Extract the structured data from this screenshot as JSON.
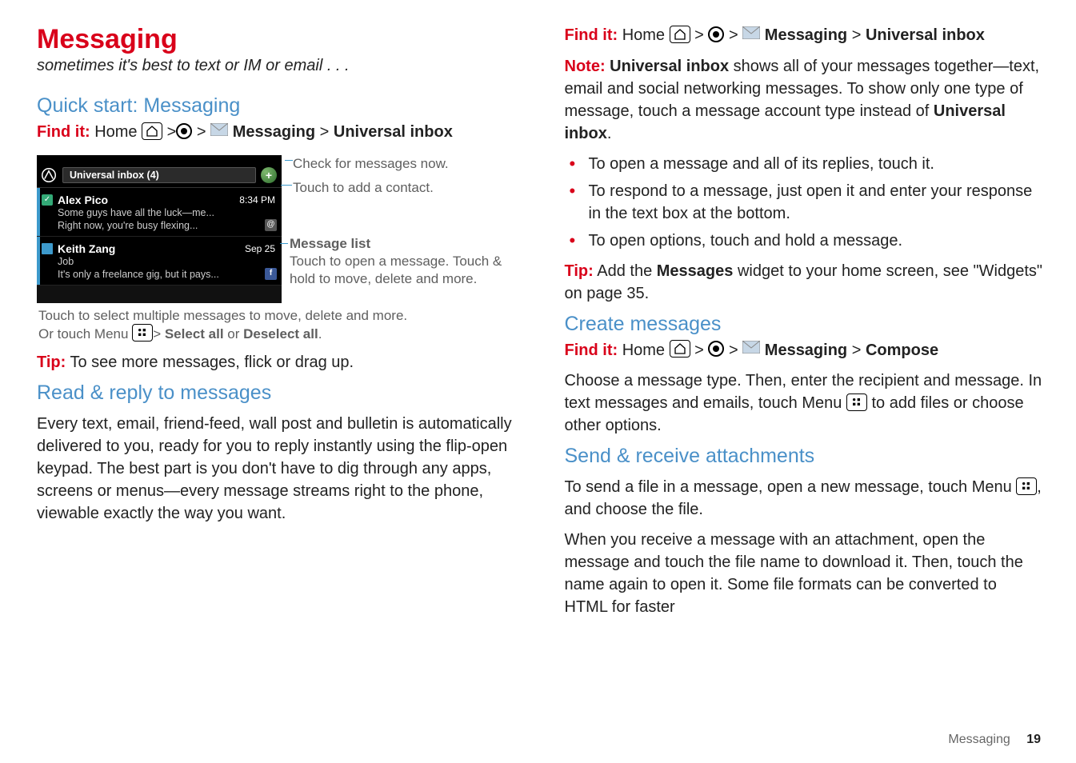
{
  "page": {
    "title": "Messaging",
    "subtitle": "sometimes it's best to text or IM or email . . .",
    "footer_label": "Messaging",
    "footer_page": "19"
  },
  "left": {
    "quick_start_heading": "Quick start: Messaging",
    "findit_label": "Find it:",
    "findit_home": "Home",
    "findit_messaging": "Messaging",
    "findit_universal": "Universal inbox",
    "tip_label": "Tip:",
    "tip_text": " To see more messages, flick or drag up.",
    "read_reply_heading": "Read & reply to messages",
    "read_reply_body": "Every text, email, friend-feed, wall post and bulletin is automatically delivered to you, ready for you to reply instantly using the flip-open keypad. The best part is you don't have to dig through any apps, screens or menus—every message streams right to the phone, viewable exactly the way you want."
  },
  "right": {
    "findit_label": "Find it:",
    "findit_home": "Home",
    "findit_messaging": "Messaging",
    "findit_universal": "Universal inbox",
    "note_label": "Note:",
    "note_text_1": " ",
    "note_bold": "Universal inbox",
    "note_text_2": " shows all of your messages together—text, email and social networking messages. To show only one type of message, touch a message account type instead of ",
    "note_bold2": "Universal inbox",
    "note_text_3": ".",
    "bullets": [
      "To open a message and all of its replies, touch it.",
      "To respond to a message, just open it and enter your response in the text box at the bottom.",
      "To open options, touch and hold a message."
    ],
    "tip_label": "Tip:",
    "tip_text_1": " Add the ",
    "tip_bold": "Messages",
    "tip_text_2": " widget to your home screen, see \"Widgets\" on page 35.",
    "create_heading": "Create messages",
    "create_findit_label": "Find it:",
    "create_home": "Home",
    "create_messaging": "Messaging",
    "create_compose": "Compose",
    "create_body1": "Choose a message type. Then, enter the recipient and message. In text messages and emails, touch Menu",
    "create_body2": " to add files or choose other options.",
    "send_heading": "Send & receive attachments",
    "send_body1": "To send a file in a message, open a new message, touch Menu",
    "send_body2": ", and choose the file.",
    "send_body3": "When you receive a message with an attachment, open the message and touch the file name to download it. Then, touch the name again to open it. Some file formats can be converted to HTML for faster"
  },
  "phone": {
    "title": "Universal inbox (4)",
    "messages": [
      {
        "name": "Alex Pico",
        "time": "8:34 PM",
        "line1": "Some guys have all the luck—me...",
        "line2": "Right now, you're busy flexing...",
        "checked": true,
        "badge": "@"
      },
      {
        "name": "Keith Zang",
        "time": "Sep 25",
        "line1": "Job",
        "line2": "It's only a freelance gig, but it pays...",
        "social": true,
        "badge": "f"
      }
    ]
  },
  "annotations": {
    "check_now": "Check for messages now.",
    "add_contact": "Touch to add a contact.",
    "msg_list_hdr": "Message list",
    "msg_list_body": "Touch to open a message. Touch & hold to move, delete and more.",
    "bottom1": "Touch to select multiple messages to move, delete and more.",
    "bottom2a": "Or touch Menu",
    "bottom2b": "> ",
    "bottom2c": "Select all",
    "bottom2d": " or ",
    "bottom2e": "Deselect all",
    "bottom2f": "."
  }
}
